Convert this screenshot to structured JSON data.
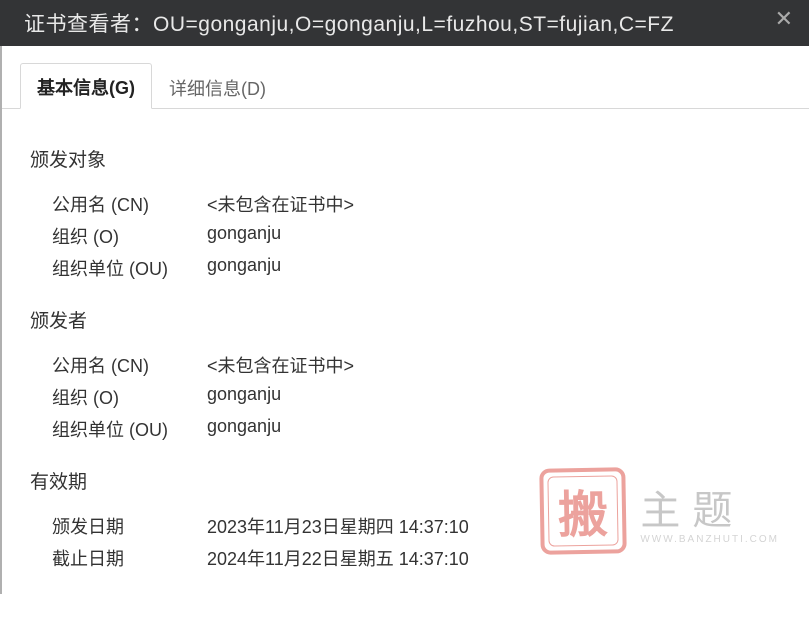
{
  "titlebar": {
    "title": "证书查看者：OU=gonganju,O=gonganju,L=fuzhou,ST=fujian,C=FZ"
  },
  "tabs": {
    "basic": "基本信息(G)",
    "details": "详细信息(D)"
  },
  "sections": {
    "subject": {
      "heading": "颁发对象",
      "cn_label": "公用名 (CN)",
      "cn_value": "<未包含在证书中>",
      "o_label": "组织 (O)",
      "o_value": "gonganju",
      "ou_label": "组织单位 (OU)",
      "ou_value": "gonganju"
    },
    "issuer": {
      "heading": "颁发者",
      "cn_label": "公用名 (CN)",
      "cn_value": "<未包含在证书中>",
      "o_label": "组织 (O)",
      "o_value": "gonganju",
      "ou_label": "组织单位 (OU)",
      "ou_value": "gonganju"
    },
    "validity": {
      "heading": "有效期",
      "issued_label": "颁发日期",
      "issued_value": "2023年11月23日星期四 14:37:10",
      "expires_label": "截止日期",
      "expires_value": "2024年11月22日星期五 14:37:10"
    }
  },
  "watermark": {
    "stamp": "搬",
    "main": "主题",
    "sub": "WWW.BANZHUTI.COM"
  }
}
